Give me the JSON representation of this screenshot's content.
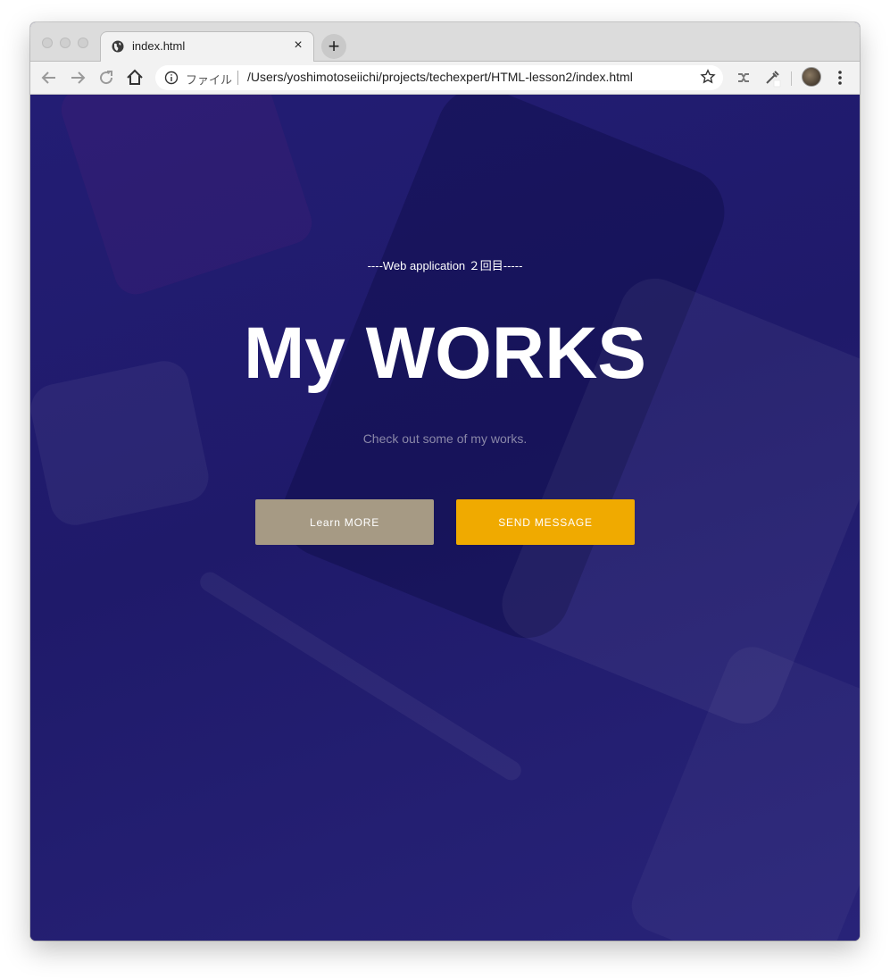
{
  "browser": {
    "tab_title": "index.html",
    "tab_close": "×",
    "new_tab": "+",
    "scheme_label": "ファイル",
    "url": "/Users/yoshimotoseiichi/projects/techexpert/HTML-lesson2/index.html"
  },
  "hero": {
    "subtitle": "----Web application ２回目-----",
    "title": "My WORKS",
    "tagline": "Check out some of my works.",
    "learn_button": "Learn MORE",
    "send_button": "SEND MESSAGE"
  },
  "colors": {
    "background": "#1f1b6e",
    "learn_button": "#a69a84",
    "send_button": "#f0aa00"
  }
}
